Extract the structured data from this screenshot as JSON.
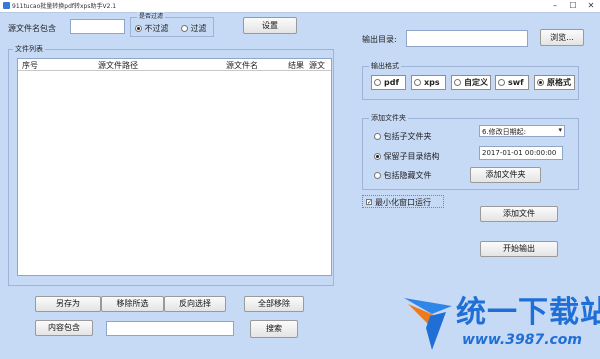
{
  "window": {
    "title": "911tucao批量转换pdf转xps助手V2.1"
  },
  "top": {
    "name_contains_label": "源文件名包含",
    "filter_title": "是否过滤",
    "no_filter_label": "不过滤",
    "filter_label": "过滤",
    "settings_button": "设置"
  },
  "file_list": {
    "group_title": "文件列表",
    "columns": [
      "序号",
      "源文件路径",
      "源文件名",
      "结果",
      "源文"
    ]
  },
  "bottom": {
    "save_as": "另存为",
    "remove_selected": "移除所选",
    "invert_selection": "反向选择",
    "remove_all": "全部移除",
    "content_contains": "内容包含",
    "search": "搜索"
  },
  "output": {
    "dir_label": "输出目录:",
    "browse_button": "浏览...",
    "format_group_title": "输出格式",
    "formats": [
      "pdf",
      "xps",
      "自定义",
      "swf",
      "原格式"
    ],
    "selected_format": "原格式"
  },
  "add_folder": {
    "group_title": "添加文件夹",
    "include_subfolders": "包括子文件夹",
    "keep_structure": "保留子目录结构",
    "include_hidden": "包括隐藏文件",
    "date_select": "6.修改日期起:",
    "date_value": "2017-01-01 00:00:00",
    "add_folder_button": "添加文件夹"
  },
  "minimize_label": "最小化窗口运行",
  "add_file_button": "添加文件",
  "start_button": "开始输出",
  "watermark": {
    "text": "统一下载站",
    "url": "www.3987.com"
  },
  "colors": {
    "background": "#c7daf5",
    "watermark_blue": "#1f6fd6",
    "watermark_orange": "#f07a1a"
  }
}
